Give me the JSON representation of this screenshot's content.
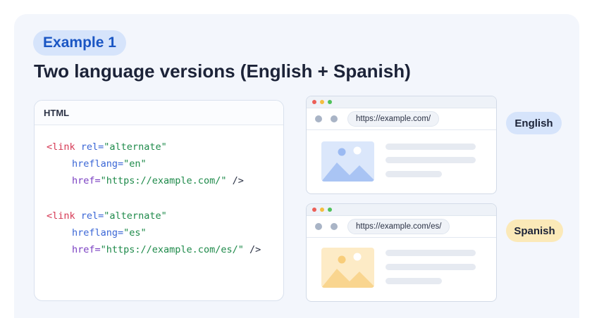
{
  "badge": {
    "label": "Example 1"
  },
  "heading": "Two language versions (English + Spanish)",
  "code_panel": {
    "title": "HTML",
    "blocks": [
      {
        "tag_open": "<link",
        "rel_attr": "rel=",
        "rel_val": "\"alternate\"",
        "hreflang_attr": "hreflang=",
        "hreflang_val": "\"en\"",
        "href_attr": "href=",
        "href_val": "\"https://example.com/\"",
        "close": " />"
      },
      {
        "tag_open": "<link",
        "rel_attr": "rel=",
        "rel_val": "\"alternate\"",
        "hreflang_attr": "hreflang=",
        "hreflang_val": "\"es\"",
        "href_attr": "href=",
        "href_val": "\"https://example.com/es/\"",
        "close": " />"
      }
    ]
  },
  "browsers": [
    {
      "url": "https://example.com/",
      "language_label": "English"
    },
    {
      "url": "https://example.com/es/",
      "language_label": "Spanish"
    }
  ],
  "colors": {
    "accent_blue": "#1a56c4",
    "english_pill": "#d6e4fb",
    "spanish_pill": "#fbe9b8",
    "code_tag": "#d63a55",
    "code_attr": "#3a66d6",
    "code_string": "#1e8a4a"
  }
}
